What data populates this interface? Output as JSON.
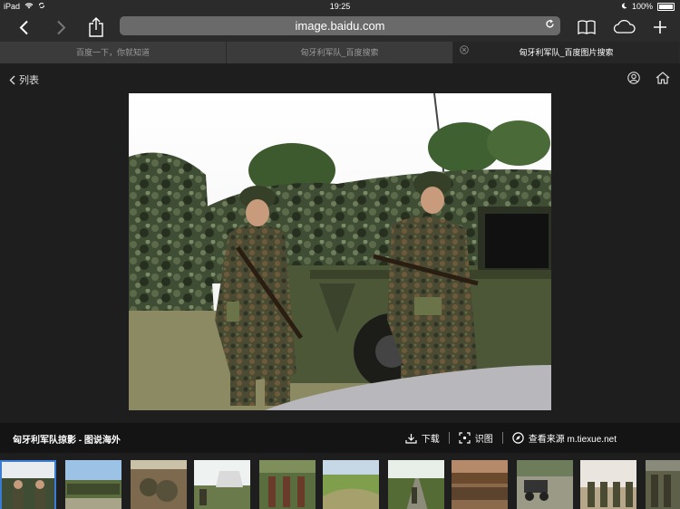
{
  "status": {
    "device": "iPad",
    "time": "19:25",
    "battery": "100%"
  },
  "browser": {
    "url": "image.baidu.com",
    "reload_icon": "reload-icon"
  },
  "tabs": [
    {
      "label": "百度一下，你就知道"
    },
    {
      "label": "匈牙利军队_百度搜索"
    },
    {
      "label": "匈牙利军队_百度图片搜索"
    }
  ],
  "nav": {
    "back_label": "列表"
  },
  "info": {
    "title": "匈牙利军队掠影 - 图说海外",
    "download_label": "下载",
    "recognize_label": "识图",
    "source_label": "查看来源 m.tiexue.net"
  },
  "thumbnails": [
    "soldiers",
    "formation",
    "troops",
    "tents",
    "parade",
    "field",
    "road",
    "crowd",
    "vehicles",
    "lineup",
    "group"
  ]
}
